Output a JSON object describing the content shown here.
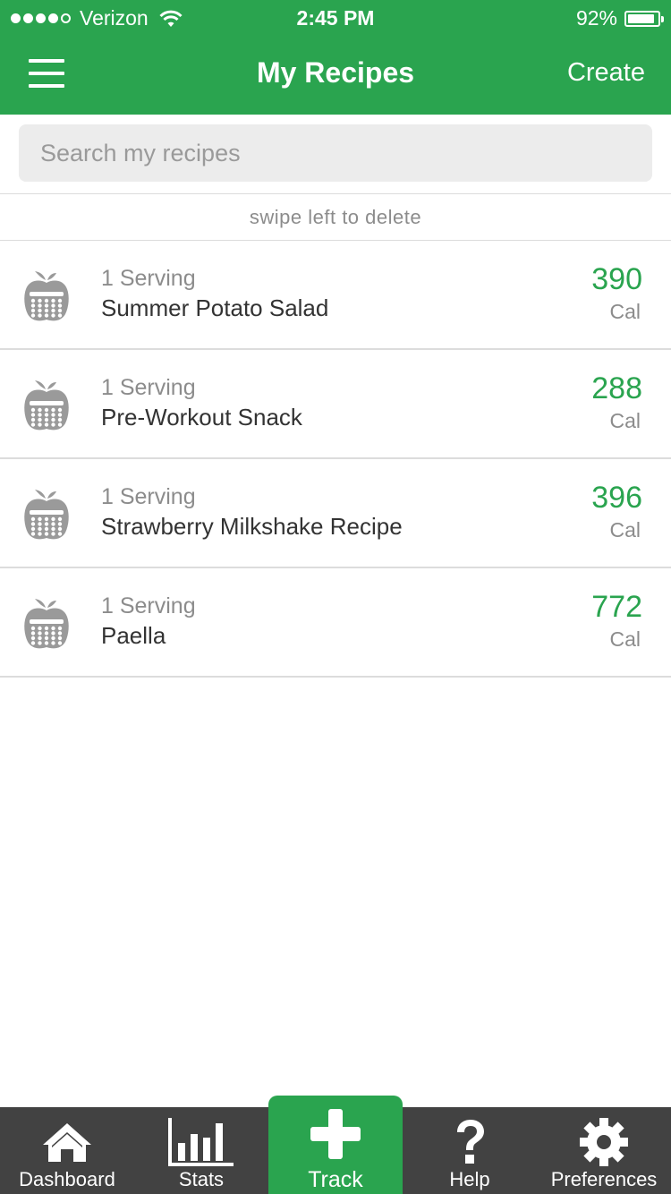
{
  "status_bar": {
    "carrier": "Verizon",
    "time": "2:45 PM",
    "battery": "92%",
    "battery_level": 0.92
  },
  "nav": {
    "title": "My Recipes",
    "create_label": "Create"
  },
  "search": {
    "placeholder": "Search my recipes",
    "value": ""
  },
  "hint": "swipe left to delete",
  "recipes": [
    {
      "servings": "1 Serving",
      "name": "Summer Potato Salad",
      "calories": "390",
      "unit": "Cal",
      "icon": "apple-calculator-icon"
    },
    {
      "servings": "1 Serving",
      "name": "Pre-Workout Snack",
      "calories": "288",
      "unit": "Cal",
      "icon": "apple-calculator-icon"
    },
    {
      "servings": "1 Serving",
      "name": "Strawberry Milkshake Recipe",
      "calories": "396",
      "unit": "Cal",
      "icon": "apple-calculator-icon"
    },
    {
      "servings": "1 Serving",
      "name": "Paella",
      "calories": "772",
      "unit": "Cal",
      "icon": "apple-calculator-icon"
    }
  ],
  "tabs": [
    {
      "label": "Dashboard",
      "icon": "home-icon"
    },
    {
      "label": "Stats",
      "icon": "bar-chart-icon"
    },
    {
      "label": "Track",
      "icon": "plus-icon",
      "active": true
    },
    {
      "label": "Help",
      "icon": "question-icon"
    },
    {
      "label": "Preferences",
      "icon": "gear-icon"
    }
  ],
  "colors": {
    "brand_green": "#2aa44f",
    "tab_bar": "#424242",
    "text_gray": "#8c8c8c",
    "text_dark": "#333333"
  }
}
